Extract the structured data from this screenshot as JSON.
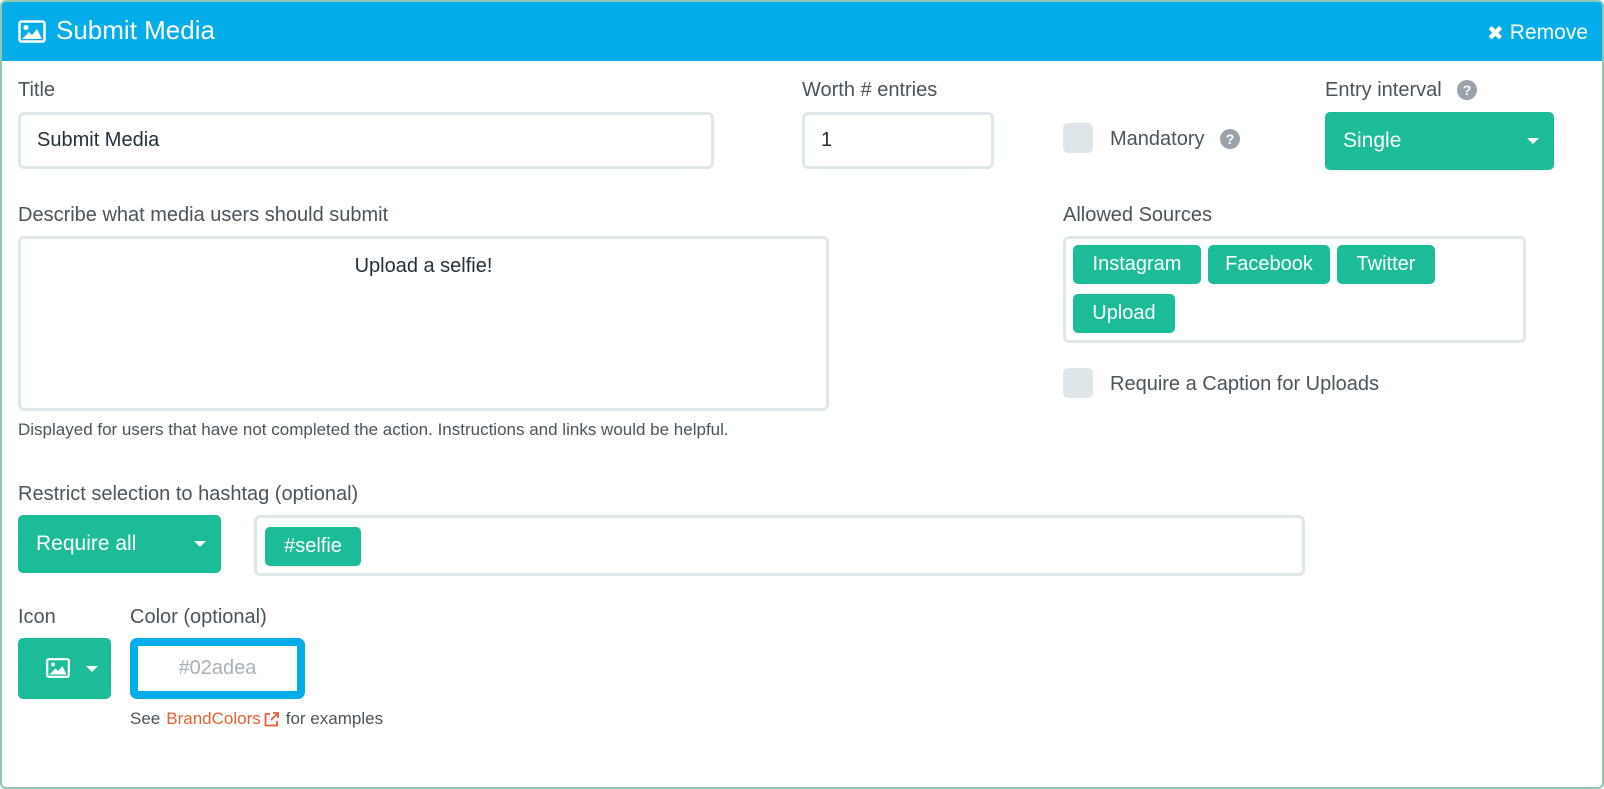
{
  "header": {
    "title": "Submit Media",
    "remove_label": "Remove",
    "icon": "image-icon",
    "background_color": "#02adea"
  },
  "form": {
    "title_label": "Title",
    "title_value": "Submit Media",
    "worth_label": "Worth # entries",
    "worth_value": "1",
    "mandatory_label": "Mandatory",
    "entry_interval_label": "Entry interval",
    "entry_interval_value": "Single",
    "describe_label": "Describe what media users should submit",
    "describe_value": "Upload a selfie!",
    "describe_help": "Displayed for users that have not completed the action. Instructions and links would be helpful.",
    "allowed_sources_label": "Allowed Sources",
    "allowed_sources": [
      "Instagram",
      "Facebook",
      "Twitter",
      "Upload"
    ],
    "require_caption_label": "Require a Caption for Uploads",
    "hashtag_label": "Restrict selection to hashtag (optional)",
    "hashtag_mode": "Require all",
    "hashtags": [
      "#selfie"
    ],
    "icon_label": "Icon",
    "color_label": "Color (optional)",
    "color_placeholder": "#02adea",
    "brand_see": "See",
    "brand_link": "BrandColors",
    "brand_suffix": "for examples"
  },
  "colors": {
    "accent": "#1cbc98",
    "link": "#ea5e33",
    "header": "#02adea"
  }
}
